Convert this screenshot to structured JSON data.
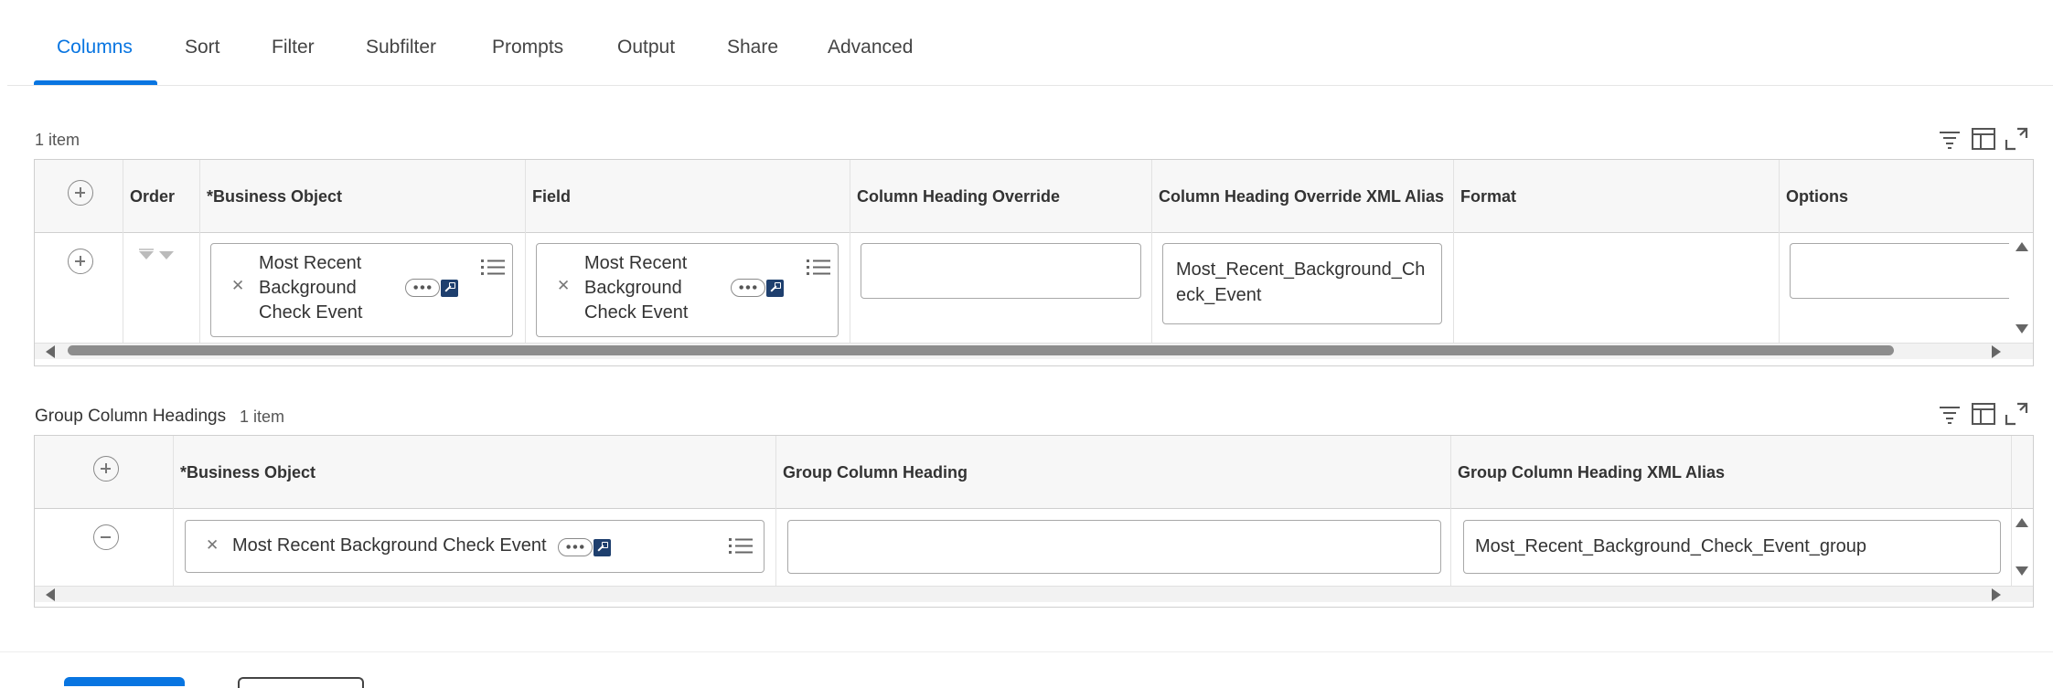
{
  "tabs": [
    {
      "label": "Columns",
      "active": true
    },
    {
      "label": "Sort"
    },
    {
      "label": "Filter"
    },
    {
      "label": "Subfilter"
    },
    {
      "label": "Prompts"
    },
    {
      "label": "Output"
    },
    {
      "label": "Share"
    },
    {
      "label": "Advanced"
    }
  ],
  "columns_table": {
    "count": "1 item",
    "headers": [
      "Order",
      "*Business Object",
      "Field",
      "Column Heading Override",
      "Column Heading Override XML Alias",
      "Format",
      "Options"
    ],
    "row": {
      "business_object": [
        "Most Recent",
        "Background",
        "Check Event"
      ],
      "field": [
        "Most Recent",
        "Background",
        "Check Event"
      ],
      "column_heading_override": "",
      "xml_alias": [
        "Most_Recent_Background_Ch",
        "eck_Event"
      ],
      "format": "",
      "options": ""
    }
  },
  "group_table": {
    "title": "Group Column Headings",
    "count": "1 item",
    "headers": [
      "*Business Object",
      "Group Column Heading",
      "Group Column Heading XML Alias"
    ],
    "row": {
      "business_object": "Most Recent Background Check Event",
      "group_column_heading": "",
      "xml_alias": "Most_Recent_Background_Check_Event_group"
    }
  },
  "icons": {
    "filter": "filter-icon",
    "columns": "column-layout-icon",
    "expand": "expand-icon",
    "remove": "remove-icon",
    "list": "prompt-list-icon",
    "related": "related-actions-icon"
  },
  "colors": {
    "accent": "#0875e1",
    "link_square": "#1e3f6e"
  }
}
